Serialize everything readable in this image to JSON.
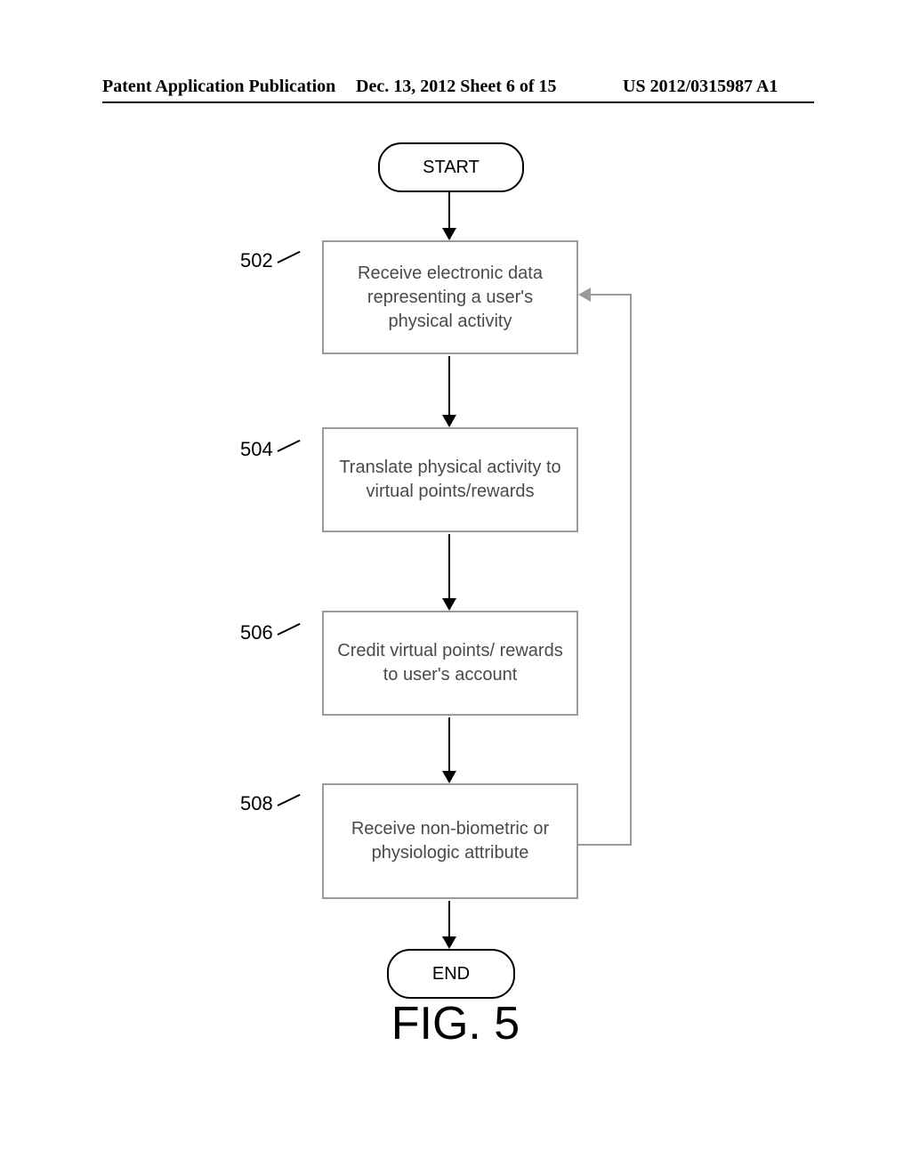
{
  "header": {
    "left": "Patent Application Publication",
    "mid": "Dec. 13, 2012  Sheet 6 of 15",
    "right": "US 2012/0315987 A1"
  },
  "flow": {
    "start": "START",
    "end": "END",
    "steps": [
      {
        "ref": "502",
        "text": "Receive electronic data representing a user's physical activity"
      },
      {
        "ref": "504",
        "text": "Translate physical activity to virtual points/rewards"
      },
      {
        "ref": "506",
        "text": "Credit virtual points/ rewards to user's account"
      },
      {
        "ref": "508",
        "text": "Receive non-biometric or physiologic attribute"
      }
    ]
  },
  "figure_label": "FIG. 5"
}
